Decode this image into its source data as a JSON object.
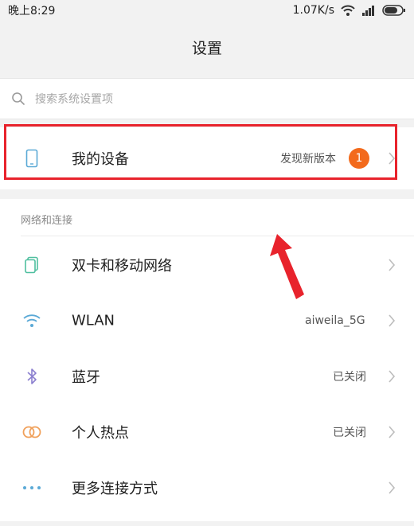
{
  "status_bar": {
    "time": "晚上8:29",
    "speed": "1.07K/s"
  },
  "header": {
    "title": "设置"
  },
  "search": {
    "placeholder": "搜索系统设置项"
  },
  "device": {
    "label": "我的设备",
    "status": "发现新版本",
    "badge": "1"
  },
  "network": {
    "section_title": "网络和连接",
    "items": [
      {
        "label": "双卡和移动网络",
        "value": "",
        "icon": "sim-card-icon"
      },
      {
        "label": "WLAN",
        "value": "aiweila_5G",
        "icon": "wifi-icon"
      },
      {
        "label": "蓝牙",
        "value": "已关闭",
        "icon": "bluetooth-icon"
      },
      {
        "label": "个人热点",
        "value": "已关闭",
        "icon": "hotspot-icon"
      },
      {
        "label": "更多连接方式",
        "value": "",
        "icon": "more-dots-icon"
      }
    ]
  },
  "colors": {
    "highlight": "#e8232c",
    "badge": "#f36a1c",
    "accent_blue": "#5aa9d6"
  }
}
